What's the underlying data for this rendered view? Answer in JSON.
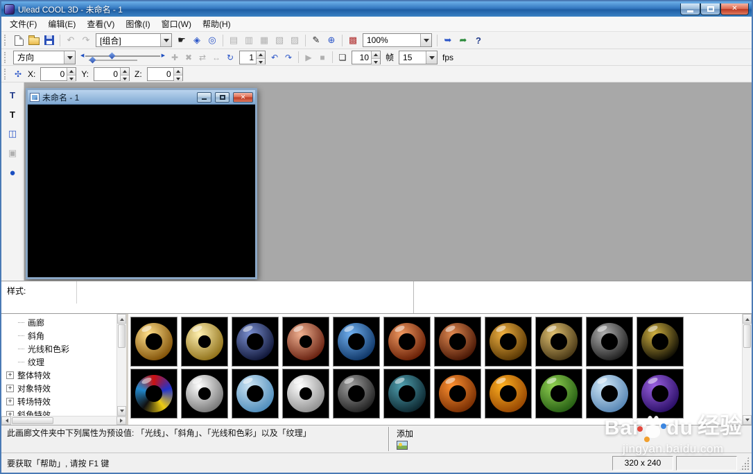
{
  "window": {
    "title": "Ulead COOL 3D - 未命名 - 1"
  },
  "menu": {
    "items": [
      {
        "label": "文件(F)"
      },
      {
        "label": "编辑(E)"
      },
      {
        "label": "查看(V)"
      },
      {
        "label": "图像(I)"
      },
      {
        "label": "窗口(W)"
      },
      {
        "label": "帮助(H)"
      }
    ]
  },
  "toolbar_main": {
    "group_combo": "[组合]",
    "zoom_combo": "100%"
  },
  "toolbar_anim": {
    "direction_combo": "方向",
    "current_frame": "1",
    "total_frames": "10",
    "frames_label": "帧",
    "fps_combo": "15",
    "fps_label": "fps"
  },
  "toolbar_pos": {
    "x_label": "X:",
    "x": "0",
    "y_label": "Y:",
    "y": "0",
    "z_label": "Z:",
    "z": "0"
  },
  "child_window": {
    "title": "未命名 - 1"
  },
  "style_label": "样式:",
  "tree": {
    "expand_glyph": "+",
    "items": [
      {
        "label": "画廊",
        "type": "leaf"
      },
      {
        "label": "斜角",
        "type": "leaf"
      },
      {
        "label": "光线和色彩",
        "type": "leaf"
      },
      {
        "label": "纹理",
        "type": "leaf"
      },
      {
        "label": "整体特效",
        "type": "branch"
      },
      {
        "label": "对象特效",
        "type": "branch"
      },
      {
        "label": "转场特效",
        "type": "branch"
      },
      {
        "label": "斜角特效",
        "type": "branch"
      }
    ]
  },
  "gallery": {
    "rows": [
      [
        {
          "name": "gold-donut",
          "hi": "#ffdf8a",
          "lo": "#7a4a00"
        },
        {
          "name": "gold-ring",
          "hi": "#fff0b0",
          "lo": "#8a6a10",
          "thin": true
        },
        {
          "name": "blue-swirl-donut",
          "hi": "#7a8fd0",
          "lo": "#0a1030"
        },
        {
          "name": "copper-ring",
          "hi": "#f0b090",
          "lo": "#601808",
          "thin": true
        },
        {
          "name": "blue-texture-donut",
          "hi": "#70b0f0",
          "lo": "#0a3060"
        },
        {
          "name": "orange-rings-donut",
          "hi": "#f09860",
          "lo": "#601800"
        },
        {
          "name": "copper-donut",
          "hi": "#e08850",
          "lo": "#401000"
        },
        {
          "name": "amber-donut",
          "hi": "#f0b040",
          "lo": "#503000"
        },
        {
          "name": "gold-bead-donut",
          "hi": "#e0c070",
          "lo": "#403010"
        },
        {
          "name": "steel-holes-donut",
          "hi": "#b0b0b0",
          "lo": "#181818"
        },
        {
          "name": "black-gold-donut",
          "hi": "#d0b040",
          "lo": "#050500"
        }
      ],
      [
        {
          "name": "stained-glass-donut",
          "conic": [
            "#cc1111",
            "#2233cc",
            "#eecc11",
            "#111111",
            "#2288cc",
            "#cc1111"
          ]
        },
        {
          "name": "silver-ring",
          "hi": "#ffffff",
          "lo": "#707070",
          "thin": true
        },
        {
          "name": "blue-marble-donut",
          "hi": "#cce4f4",
          "lo": "#4888b8"
        },
        {
          "name": "white-ring",
          "hi": "#ffffff",
          "lo": "#8a8a8a",
          "thin": true
        },
        {
          "name": "gray-donut",
          "hi": "#a0a0a0",
          "lo": "#1a1a1a"
        },
        {
          "name": "teal-texture-donut",
          "hi": "#50a0b0",
          "lo": "#082028"
        },
        {
          "name": "orange-donut",
          "hi": "#ff9030",
          "lo": "#702800"
        },
        {
          "name": "amber-gradient-donut",
          "hi": "#ffb020",
          "lo": "#904000"
        },
        {
          "name": "green-donut",
          "hi": "#90d050",
          "lo": "#205810"
        },
        {
          "name": "cloud-donut",
          "hi": "#d0e8f8",
          "lo": "#5080b0"
        },
        {
          "name": "purple-donut",
          "hi": "#9a60e0",
          "lo": "#240a60"
        }
      ]
    ]
  },
  "info_text": "此画廊文件夹中下列属性为预设值: 「光线」、「斜角」、「光线和色彩」以及「纹理」",
  "add_label": "添加",
  "status": {
    "help_text": "要获取「帮助」, 请按 F1 键",
    "size_text": "320 x 240"
  },
  "watermark": {
    "brand_prefix": "Bai",
    "brand_suffix": "du",
    "brand_cn": "经验",
    "url": "jingyan.baidu.com"
  },
  "icons": {
    "close": "✕",
    "undo": "↶",
    "redo": "↷",
    "pan_hand": "☛",
    "object_select": "◈",
    "render_target": "◎",
    "quality_1": "▤",
    "quality_2": "▥",
    "quality_3": "▦",
    "quality_4": "▧",
    "quality_5": "▨",
    "annotate_pen": "✎",
    "web_globe": "⊕",
    "color_panel": "▩",
    "export_video": "➥",
    "export_image": "➦",
    "context_help": "?",
    "kf_insert": "✚",
    "kf_delete": "✖",
    "kf_reverse": "⇄",
    "kf_loop": "↔",
    "rotate_object": "↻",
    "prev_key": "↶",
    "next_key": "↷",
    "play": "▶",
    "stop": "■",
    "render_anim": "❏",
    "axis": "✣",
    "insert_text": "T",
    "edit_text": "T",
    "insert_graphics": "◫",
    "edit_object": "▣",
    "sphere": "●",
    "new_file": "css-page-shape",
    "open_folder": "css-folder-shape",
    "save": "css-floppy-shape",
    "add": "css-image-shape",
    "minimize": "css-bar-shape",
    "maximize": "css-box-shape"
  },
  "colors": {
    "titlebar_blue": "#2f74b8",
    "workspace_gray": "#a8a8a8",
    "close_red": "#bb3a24",
    "accent_blue": "#2a55c8"
  }
}
